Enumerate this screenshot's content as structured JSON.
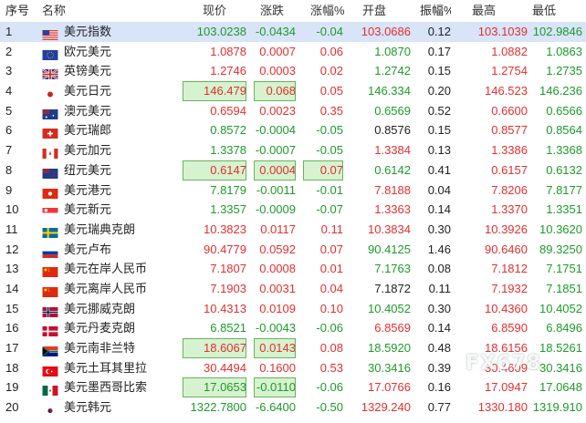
{
  "headers": {
    "idx": "序号",
    "name": "名称",
    "price": "现价",
    "change": "涨跌",
    "pct": "涨幅%",
    "open": "开盘",
    "amplitude": "振幅%",
    "high": "最高",
    "low": "最低"
  },
  "watermark": "FX678",
  "colors": {
    "up": "#e03030",
    "down": "#1e9a2b",
    "selected": "#d8e4f8",
    "highlight": "#d7f2cf"
  },
  "rows": [
    {
      "idx": "1",
      "name": "美元指数",
      "flag": "us",
      "price": "103.0238",
      "change": "-0.0434",
      "pct": "-0.04",
      "open": "103.0686",
      "amplitude": "0.12",
      "high": "103.1039",
      "low": "102.9846",
      "dir": "down",
      "open_dir": "up",
      "high_dir": "up",
      "low_dir": "down",
      "selected": true
    },
    {
      "idx": "2",
      "name": "欧元美元",
      "flag": "eu",
      "price": "1.0878",
      "change": "0.0007",
      "pct": "0.06",
      "open": "1.0870",
      "amplitude": "0.17",
      "high": "1.0882",
      "low": "1.0863",
      "dir": "up",
      "open_dir": "down",
      "high_dir": "up",
      "low_dir": "down"
    },
    {
      "idx": "3",
      "name": "英镑美元",
      "flag": "gb",
      "price": "1.2746",
      "change": "0.0003",
      "pct": "0.02",
      "open": "1.2742",
      "amplitude": "0.15",
      "high": "1.2754",
      "low": "1.2735",
      "dir": "up",
      "open_dir": "down",
      "high_dir": "up",
      "low_dir": "down"
    },
    {
      "idx": "4",
      "name": "美元日元",
      "flag": "jp",
      "price": "146.479",
      "change": "0.068",
      "pct": "0.05",
      "open": "146.334",
      "amplitude": "0.20",
      "high": "146.523",
      "low": "146.236",
      "dir": "up",
      "open_dir": "down",
      "high_dir": "up",
      "low_dir": "down",
      "hl_price": true,
      "hl_change": true
    },
    {
      "idx": "5",
      "name": "澳元美元",
      "flag": "au",
      "price": "0.6594",
      "change": "0.0023",
      "pct": "0.35",
      "open": "0.6569",
      "amplitude": "0.52",
      "high": "0.6600",
      "low": "0.6566",
      "dir": "up",
      "open_dir": "down",
      "high_dir": "up",
      "low_dir": "down"
    },
    {
      "idx": "6",
      "name": "美元瑞郎",
      "flag": "ch",
      "price": "0.8572",
      "change": "-0.0004",
      "pct": "-0.05",
      "open": "0.8576",
      "amplitude": "0.15",
      "high": "0.8577",
      "low": "0.8564",
      "dir": "down",
      "open_dir": "flat",
      "high_dir": "up",
      "low_dir": "down"
    },
    {
      "idx": "7",
      "name": "美元加元",
      "flag": "ca",
      "price": "1.3378",
      "change": "-0.0007",
      "pct": "-0.05",
      "open": "1.3384",
      "amplitude": "0.13",
      "high": "1.3386",
      "low": "1.3368",
      "dir": "down",
      "open_dir": "up",
      "high_dir": "up",
      "low_dir": "down"
    },
    {
      "idx": "8",
      "name": "纽元美元",
      "flag": "nz",
      "price": "0.6147",
      "change": "0.0004",
      "pct": "0.07",
      "open": "0.6142",
      "amplitude": "0.41",
      "high": "0.6157",
      "low": "0.6132",
      "dir": "up",
      "open_dir": "down",
      "high_dir": "up",
      "low_dir": "down",
      "hl_price": true,
      "hl_change": true,
      "hl_pct": true
    },
    {
      "idx": "9",
      "name": "美元港元",
      "flag": "hk",
      "price": "7.8179",
      "change": "-0.0011",
      "pct": "-0.01",
      "open": "7.8188",
      "amplitude": "0.04",
      "high": "7.8206",
      "low": "7.8177",
      "dir": "down",
      "open_dir": "up",
      "high_dir": "up",
      "low_dir": "down"
    },
    {
      "idx": "10",
      "name": "美元新元",
      "flag": "sg",
      "price": "1.3357",
      "change": "-0.0009",
      "pct": "-0.07",
      "open": "1.3363",
      "amplitude": "0.14",
      "high": "1.3370",
      "low": "1.3351",
      "dir": "down",
      "open_dir": "up",
      "high_dir": "up",
      "low_dir": "down"
    },
    {
      "idx": "11",
      "name": "美元瑞典克朗",
      "flag": "se",
      "price": "10.3823",
      "change": "0.0117",
      "pct": "0.11",
      "open": "10.3834",
      "amplitude": "0.30",
      "high": "10.3926",
      "low": "10.3620",
      "dir": "up",
      "open_dir": "up",
      "high_dir": "up",
      "low_dir": "down"
    },
    {
      "idx": "12",
      "name": "美元卢布",
      "flag": "ru",
      "price": "90.4779",
      "change": "0.0592",
      "pct": "0.07",
      "open": "90.4125",
      "amplitude": "1.46",
      "high": "90.6460",
      "low": "89.3250",
      "dir": "up",
      "open_dir": "down",
      "high_dir": "up",
      "low_dir": "down"
    },
    {
      "idx": "13",
      "name": "美元在岸人民币",
      "flag": "cn",
      "price": "7.1807",
      "change": "0.0008",
      "pct": "0.01",
      "open": "7.1763",
      "amplitude": "0.08",
      "high": "7.1812",
      "low": "7.1751",
      "dir": "up",
      "open_dir": "down",
      "high_dir": "up",
      "low_dir": "down"
    },
    {
      "idx": "14",
      "name": "美元离岸人民币",
      "flag": "cn",
      "price": "7.1903",
      "change": "0.0031",
      "pct": "0.04",
      "open": "7.1872",
      "amplitude": "0.11",
      "high": "7.1932",
      "low": "7.1851",
      "dir": "up",
      "open_dir": "flat",
      "high_dir": "up",
      "low_dir": "down"
    },
    {
      "idx": "15",
      "name": "美元挪威克朗",
      "flag": "no",
      "price": "10.4313",
      "change": "0.0109",
      "pct": "0.10",
      "open": "10.4052",
      "amplitude": "0.30",
      "high": "10.4360",
      "low": "10.4052",
      "dir": "up",
      "open_dir": "down",
      "high_dir": "up",
      "low_dir": "down"
    },
    {
      "idx": "16",
      "name": "美元丹麦克朗",
      "flag": "dk",
      "price": "6.8521",
      "change": "-0.0043",
      "pct": "-0.06",
      "open": "6.8569",
      "amplitude": "0.14",
      "high": "6.8590",
      "low": "6.8496",
      "dir": "down",
      "open_dir": "up",
      "high_dir": "up",
      "low_dir": "down"
    },
    {
      "idx": "17",
      "name": "美元南非兰特",
      "flag": "za",
      "price": "18.6067",
      "change": "0.0143",
      "pct": "0.08",
      "open": "18.5920",
      "amplitude": "0.48",
      "high": "18.6156",
      "low": "18.5261",
      "dir": "up",
      "open_dir": "down",
      "high_dir": "up",
      "low_dir": "down",
      "hl_price": true,
      "hl_change": true
    },
    {
      "idx": "18",
      "name": "美元土耳其里拉",
      "flag": "tr",
      "price": "30.4494",
      "change": "0.1600",
      "pct": "0.53",
      "open": "30.3416",
      "amplitude": "0.39",
      "high": "30.4609",
      "low": "30.3416",
      "dir": "up",
      "open_dir": "down",
      "high_dir": "up",
      "low_dir": "down"
    },
    {
      "idx": "19",
      "name": "美元墨西哥比索",
      "flag": "mx",
      "price": "17.0653",
      "change": "-0.0110",
      "pct": "-0.06",
      "open": "17.0766",
      "amplitude": "0.16",
      "high": "17.0947",
      "low": "17.0648",
      "dir": "down",
      "open_dir": "up",
      "high_dir": "up",
      "low_dir": "down",
      "hl_price": true,
      "hl_change": true
    },
    {
      "idx": "20",
      "name": "美元韩元",
      "flag": "kr",
      "price": "1322.7800",
      "change": "-6.6400",
      "pct": "-0.50",
      "open": "1329.240",
      "amplitude": "0.77",
      "high": "1330.180",
      "low": "1319.910",
      "dir": "down",
      "open_dir": "up",
      "high_dir": "up",
      "low_dir": "down"
    }
  ]
}
